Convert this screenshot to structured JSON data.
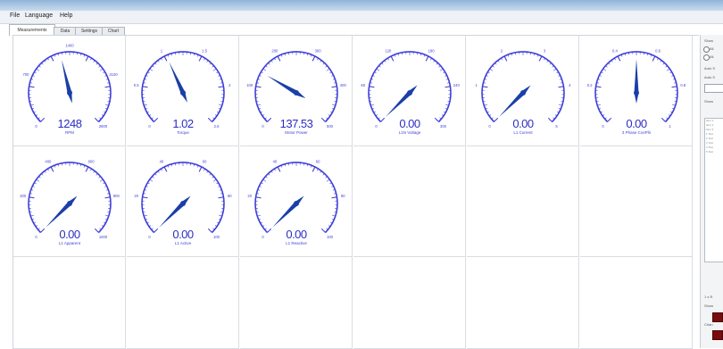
{
  "menu": {
    "items": [
      "File",
      "Language",
      "Help"
    ]
  },
  "tabs": [
    {
      "label": "Measurements",
      "active": true
    },
    {
      "label": "Data",
      "active": false
    },
    {
      "label": "Settings",
      "active": false
    },
    {
      "label": "Chart",
      "active": false
    }
  ],
  "colors": {
    "gauge": "#3f3fd8",
    "readout": "#2d2dc2",
    "needle": "#1a3fa8",
    "dark_red": "#7a0c0c"
  },
  "gauges": [
    {
      "label": "RPM",
      "min": "0",
      "max": "2800",
      "ticks": [
        "0",
        "700",
        "1400",
        "2100",
        "2800"
      ],
      "readout": "1248",
      "fraction": 0.45
    },
    {
      "label": "Torque",
      "min": "0",
      "max": "2.5",
      "ticks": [
        "0",
        "0.5",
        "1",
        "1.5",
        "2",
        "2.5"
      ],
      "readout": "1.02",
      "fraction": 0.41
    },
    {
      "label": "Motor Power",
      "min": "0",
      "max": "500",
      "ticks": [
        "0",
        "100",
        "200",
        "300",
        "400",
        "500"
      ],
      "readout": "137.53",
      "fraction": 0.28
    },
    {
      "label": "L1N Voltage",
      "min": "0",
      "max": "300",
      "ticks": [
        "0",
        "60",
        "120",
        "180",
        "240",
        "300"
      ],
      "readout": "0.00",
      "fraction": 0
    },
    {
      "label": "L1 Current",
      "min": "0",
      "max": "5",
      "ticks": [
        "0",
        "1",
        "2",
        "3",
        "4",
        "5"
      ],
      "readout": "0.00",
      "fraction": 0
    },
    {
      "label": "3 Phase CosPhi",
      "min": "0",
      "max": "1",
      "ticks": [
        "0",
        "0.2",
        "0.4",
        "0.6",
        "0.8",
        "1"
      ],
      "readout": "0.00",
      "fraction": 0.5
    },
    {
      "label": "L1 Apparent",
      "min": "0",
      "max": "1000",
      "ticks": [
        "0",
        "200",
        "400",
        "600",
        "800",
        "1000"
      ],
      "readout": "0.00",
      "fraction": 0
    },
    {
      "label": "L1 Active",
      "min": "0",
      "max": "100",
      "ticks": [
        "0",
        "20",
        "40",
        "60",
        "80",
        "100"
      ],
      "readout": "0.00",
      "fraction": 0
    },
    {
      "label": "L1 Reactive",
      "min": "0",
      "max": "100",
      "ticks": [
        "0",
        "20",
        "40",
        "60",
        "80",
        "100"
      ],
      "readout": "0.00",
      "fraction": 0
    }
  ],
  "sidebar": {
    "texts": [
      "Show",
      "All",
      "All",
      "Auto S",
      "Auto S",
      "Show"
    ],
    "list": [
      "Item 1",
      "Item 2",
      "Item 3",
      "1 Text",
      "2 Text",
      "3 Text",
      "4 Text",
      "5 Text"
    ],
    "bottom_texts": [
      "1 s R",
      "Show",
      "Chan"
    ]
  }
}
